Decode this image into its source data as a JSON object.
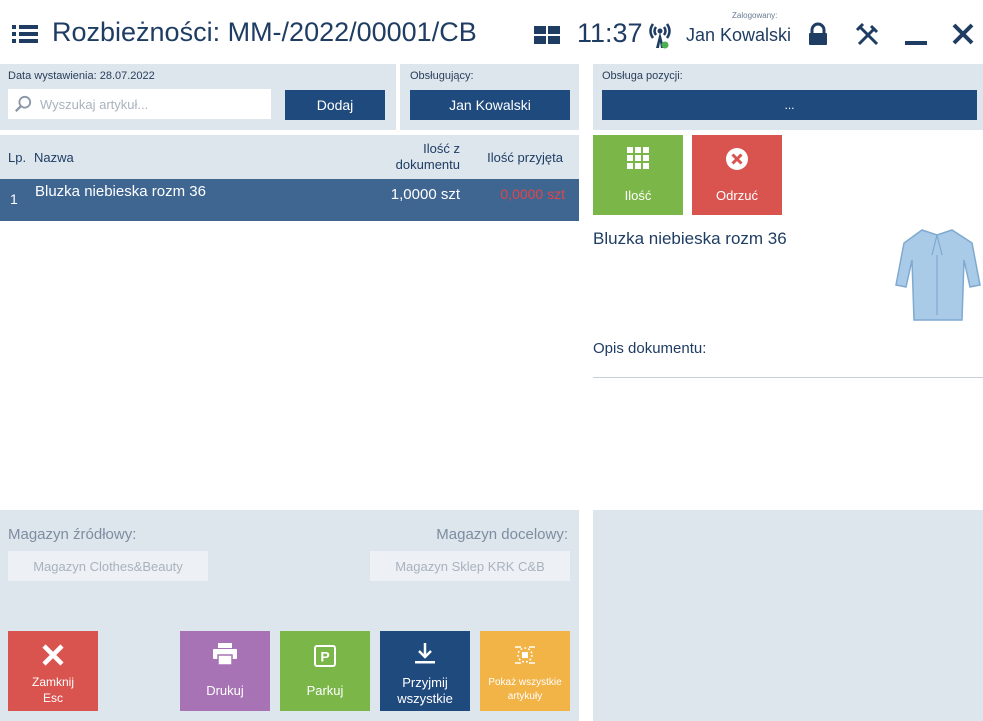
{
  "header": {
    "title": "Rozbieżności: MM-/2022/00001/CB",
    "clock": "11:37",
    "logged_label": "Zalogowany:",
    "user_name": "Jan Kowalski"
  },
  "doc": {
    "issue_date": "Data wystawienia: 28.07.2022",
    "search_placeholder": "Wyszukaj artykuł...",
    "add_label": "Dodaj",
    "handler_label": "Obsługujący:",
    "handler_value": "Jan Kowalski",
    "position_label": "Obsługa pozycji:",
    "position_value": "..."
  },
  "table": {
    "columns": [
      "Lp.",
      "Nazwa",
      "Ilość z\ndokumentu",
      "Ilość przyjęta"
    ],
    "col_qty_doc_line1": "Ilość z",
    "col_qty_doc_line2": "dokumentu",
    "rows": [
      {
        "lp": "1",
        "name": "Bluzka niebieska rozm 36",
        "qty_doc": "1,0000 szt",
        "qty_received": "0,0000 szt"
      }
    ]
  },
  "actions": {
    "quantity_label": "Ilość",
    "reject_label": "Odrzuć"
  },
  "detail": {
    "item_name": "Bluzka niebieska rozm 36",
    "doc_desc_label": "Opis dokumentu:"
  },
  "warehouse": {
    "source_label": "Magazyn źródłowy:",
    "source_value": "Magazyn Clothes&Beauty",
    "target_label": "Magazyn docelowy:",
    "target_value": "Magazyn Sklep KRK C&B"
  },
  "bottom": {
    "close_line1": "Zamknij",
    "close_line2": "Esc",
    "print": "Drukuj",
    "park": "Parkuj",
    "accept_line1": "Przyjmij",
    "accept_line2": "wszystkie",
    "show_line1": "Pokaż wszystkie",
    "show_line2": "artykuły"
  },
  "colors": {
    "accent_dark": "#1f4a7e",
    "row_selected": "#3f6591",
    "green": "#7ab648",
    "red": "#d9534f",
    "purple": "#a873b4",
    "orange": "#f2b347",
    "received_red": "#e0454a"
  }
}
